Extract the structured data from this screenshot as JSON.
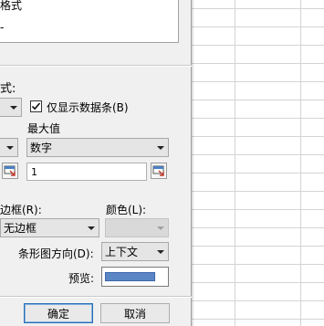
{
  "rule_list": {
    "items": [
      "格式",
      "-"
    ]
  },
  "section": {
    "heading_fragment": "式:"
  },
  "show_bar_only": {
    "label": "仅显示数据条(B)",
    "checked": true
  },
  "min": {
    "type_select": "",
    "value": ""
  },
  "max": {
    "label": "最大值",
    "type_select": "数字",
    "value": "1"
  },
  "border": {
    "label": "边框(R):",
    "select": "无边框"
  },
  "color": {
    "label": "颜色(L):",
    "select": ""
  },
  "direction": {
    "label": "条形图方向(D):",
    "select": "上下文"
  },
  "preview": {
    "label": "预览:",
    "bar_color": "#5b86c6"
  },
  "buttons": {
    "ok": "确定",
    "cancel": "取消"
  }
}
